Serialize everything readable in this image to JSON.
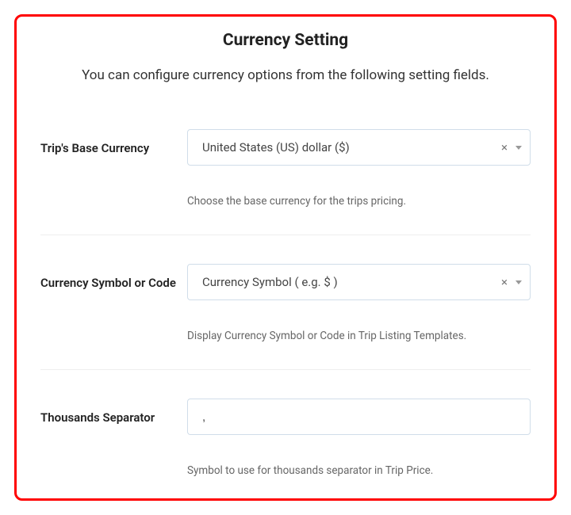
{
  "title": "Currency Setting",
  "subtitle": "You can configure currency options from the following setting fields.",
  "fields": {
    "base_currency": {
      "label": "Trip's Base Currency",
      "value": "United States (US) dollar ($)",
      "help": "Choose the base currency for the trips pricing."
    },
    "symbol_or_code": {
      "label": "Currency Symbol or Code",
      "value": "Currency Symbol ( e.g. $ )",
      "help": "Display Currency Symbol or Code in Trip Listing Templates."
    },
    "thousands_sep": {
      "label": "Thousands Separator",
      "value": ",",
      "help": "Symbol to use for thousands separator in Trip Price."
    }
  }
}
